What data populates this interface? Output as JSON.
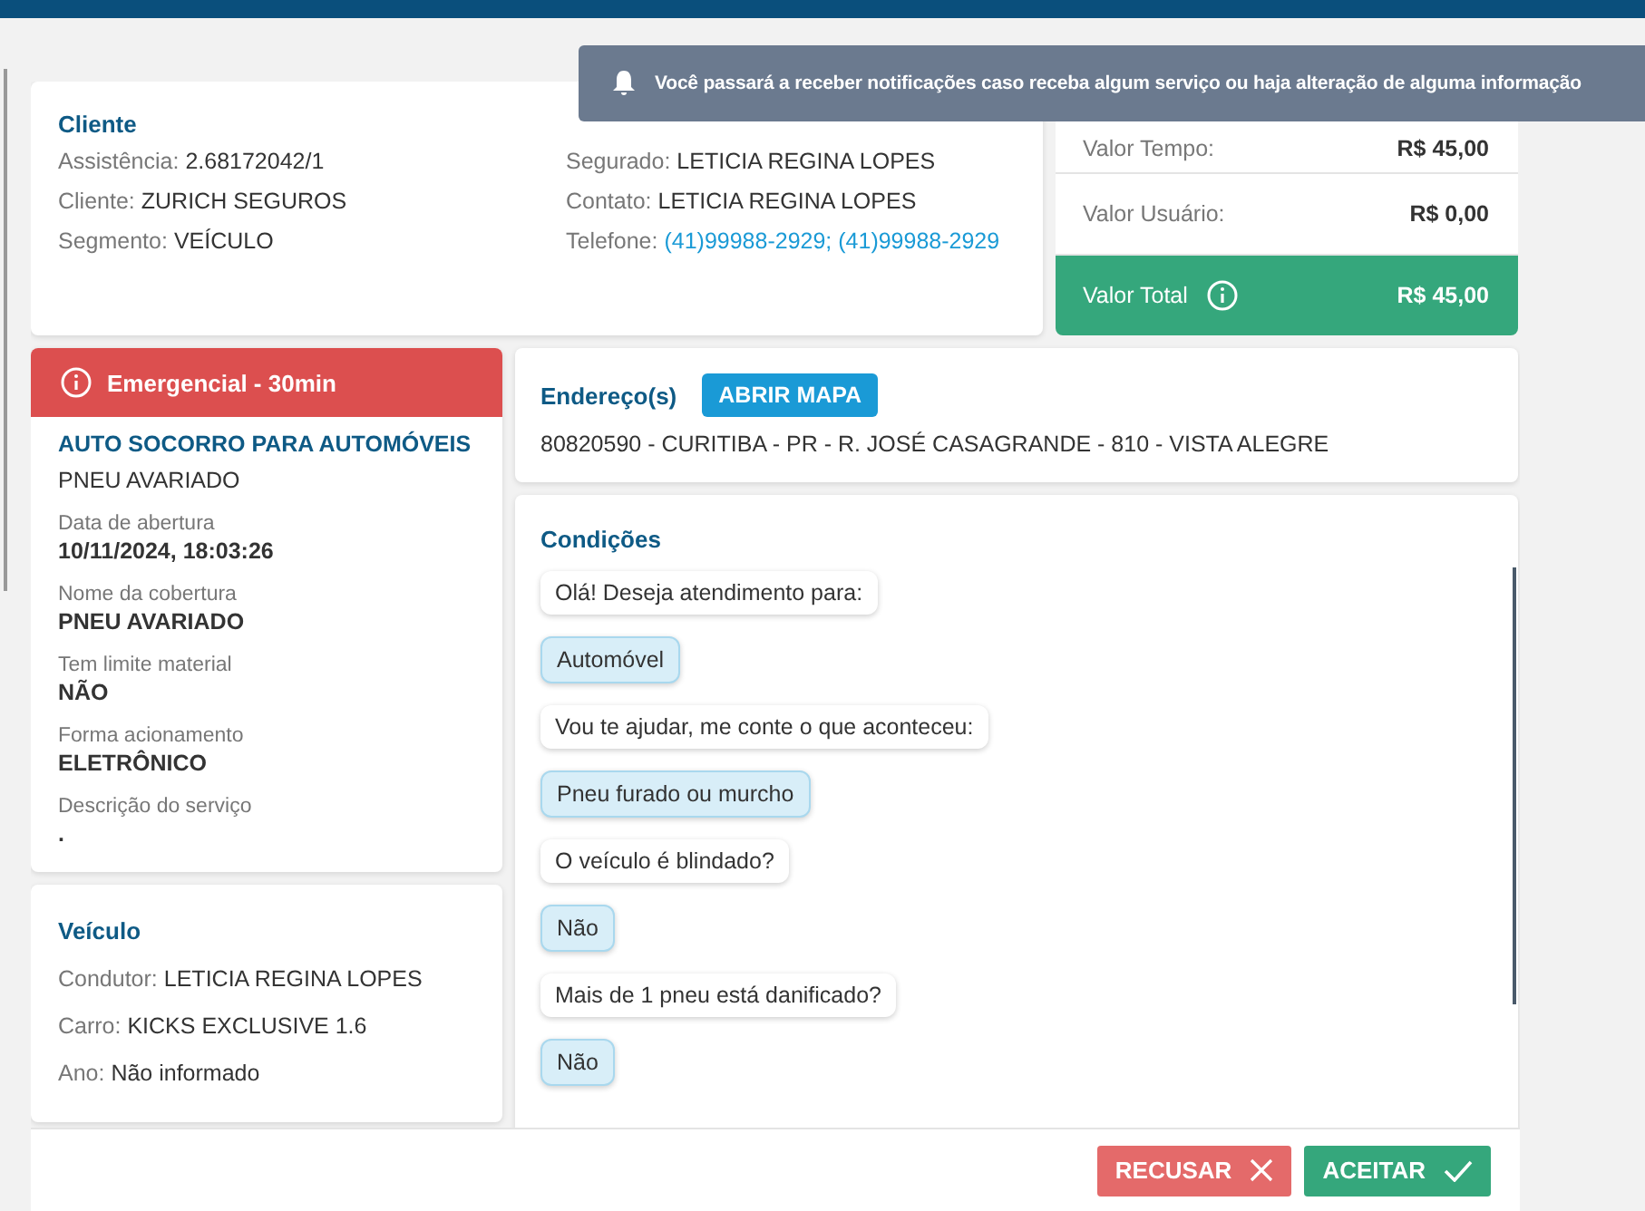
{
  "toast": {
    "text": "Você passará a receber notificações caso receba algum serviço ou haja alteração de alguma informação"
  },
  "client": {
    "title": "Cliente",
    "columns": [
      [
        {
          "label": "Assistência:",
          "value": "2.68172042/1",
          "kind": "text"
        },
        {
          "label": "Cliente:",
          "value": "ZURICH SEGUROS",
          "kind": "text"
        },
        {
          "label": "Segmento:",
          "value": "VEÍCULO",
          "kind": "text"
        }
      ],
      [
        {
          "label": "Segurado:",
          "value": "LETICIA REGINA LOPES",
          "kind": "text"
        },
        {
          "label": "Contato:",
          "value": "LETICIA REGINA LOPES",
          "kind": "text"
        },
        {
          "label": "Telefone:",
          "value": "(41)99988-2929; (41)99988-2929",
          "kind": "link"
        }
      ]
    ]
  },
  "values": [
    {
      "label": "Valor Tempo:",
      "value": "R$ 45,00",
      "kind": "plain"
    },
    {
      "label": "Valor Usuário:",
      "value": "R$ 0,00",
      "kind": "plain"
    },
    {
      "label": "Valor Total",
      "value": "R$ 45,00",
      "kind": "total"
    }
  ],
  "service": {
    "alert": "Emergencial - 30min",
    "title": "AUTO SOCORRO PARA AUTOMÓVEIS",
    "subtitle": "PNEU AVARIADO",
    "details": [
      {
        "label": "Data de abertura",
        "value": "10/11/2024, 18:03:26"
      },
      {
        "label": "Nome da cobertura",
        "value": "PNEU AVARIADO"
      },
      {
        "label": "Tem limite material",
        "value": "NÃO"
      },
      {
        "label": "Forma acionamento",
        "value": "ELETRÔNICO"
      },
      {
        "label": "Descrição do serviço",
        "value": "."
      }
    ]
  },
  "vehicle": {
    "title": "Veículo",
    "fields": [
      {
        "label": "Condutor:",
        "value": "LETICIA REGINA LOPES"
      },
      {
        "label": "Carro:",
        "value": "KICKS EXCLUSIVE 1.6"
      },
      {
        "label": "Ano:",
        "value": "Não informado"
      }
    ]
  },
  "address": {
    "title": "Endereço(s)",
    "button": "ABRIR MAPA",
    "text": "80820590 - CURITIBA - PR - R. JOSÉ CASAGRANDE - 810 - VISTA ALEGRE"
  },
  "conditions": {
    "title": "Condições",
    "messages": [
      {
        "kind": "question",
        "text": "Olá! Deseja atendimento para:"
      },
      {
        "kind": "answer",
        "text": "Automóvel"
      },
      {
        "kind": "question",
        "text": "Vou te ajudar, me conte o que aconteceu:"
      },
      {
        "kind": "answer",
        "text": "Pneu furado ou murcho"
      },
      {
        "kind": "question",
        "text": "O veículo é blindado?"
      },
      {
        "kind": "answer",
        "text": "Não"
      },
      {
        "kind": "question",
        "text": "Mais de 1 pneu está danificado?"
      },
      {
        "kind": "answer",
        "text": "Não"
      }
    ]
  },
  "actions": [
    {
      "label": "RECUSAR",
      "kind": "reject"
    },
    {
      "label": "ACEITAR",
      "kind": "accept"
    }
  ]
}
